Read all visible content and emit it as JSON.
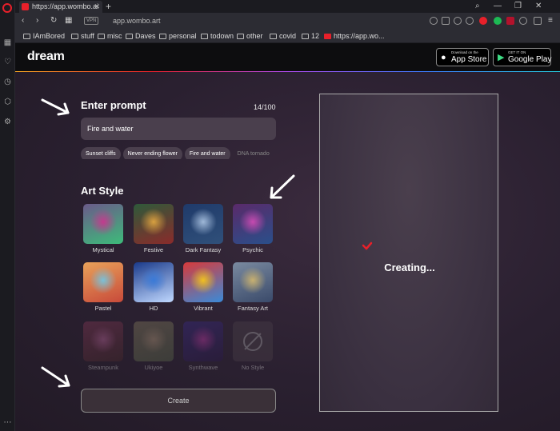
{
  "browser": {
    "tab_title": "https://app.wombo.ai",
    "url": "app.wombo.art",
    "vpn_label": "VPN",
    "bookmarks": [
      "IAmBored",
      "stuff",
      "misc",
      "Daves",
      "personal",
      "todown",
      "other",
      "covid",
      "12",
      "https://app.wo..."
    ]
  },
  "site": {
    "brand": "dream",
    "app_store_small": "Download on the",
    "app_store_large": "App Store",
    "play_small": "GET IT ON",
    "play_large": "Google Play"
  },
  "prompt": {
    "label": "Enter prompt",
    "counter": "14/100",
    "value": "Fire and water",
    "suggestions": [
      "Sunset cliffs",
      "Never ending flower",
      "Fire and water",
      "DNA tornado"
    ]
  },
  "art_style": {
    "label": "Art Style",
    "styles": [
      {
        "name": "Mystical",
        "colors": [
          "#6b5a8a",
          "#c43a8e",
          "#3dbb7a"
        ]
      },
      {
        "name": "Festive",
        "colors": [
          "#2e5a3a",
          "#d8a040",
          "#8a2b2b"
        ]
      },
      {
        "name": "Dark Fantasy",
        "colors": [
          "#1f3a6a",
          "#9fb8d8",
          "#30507a"
        ]
      },
      {
        "name": "Psychic",
        "colors": [
          "#5a2a6a",
          "#c64ab0",
          "#2a4f8a"
        ]
      },
      {
        "name": "Pastel",
        "colors": [
          "#e8a25a",
          "#7ac0d8",
          "#c84a3a"
        ]
      },
      {
        "name": "HD",
        "colors": [
          "#1a3a8a",
          "#3a7ad8",
          "#c0d8ff"
        ]
      },
      {
        "name": "Vibrant",
        "colors": [
          "#d83a3a",
          "#f0c020",
          "#3a8ad8"
        ]
      },
      {
        "name": "Fantasy Art",
        "colors": [
          "#7a8aa0",
          "#c8b070",
          "#3a4a6a"
        ]
      },
      {
        "name": "Steampunk",
        "colors": [
          "#8a3a5a",
          "#c86aa0",
          "#4a2a2a"
        ]
      },
      {
        "name": "Ukiyoe",
        "colors": [
          "#8a8060",
          "#c0a880",
          "#5a6a4a"
        ]
      },
      {
        "name": "Synthwave",
        "colors": [
          "#3a2a8a",
          "#c83ab0",
          "#2a1a4a"
        ]
      },
      {
        "name": "No Style",
        "colors": []
      }
    ]
  },
  "create_button": "Create",
  "status": "Creating...",
  "colors": {
    "accent_red": "#e8202a",
    "panel": "#4a3f4d"
  }
}
